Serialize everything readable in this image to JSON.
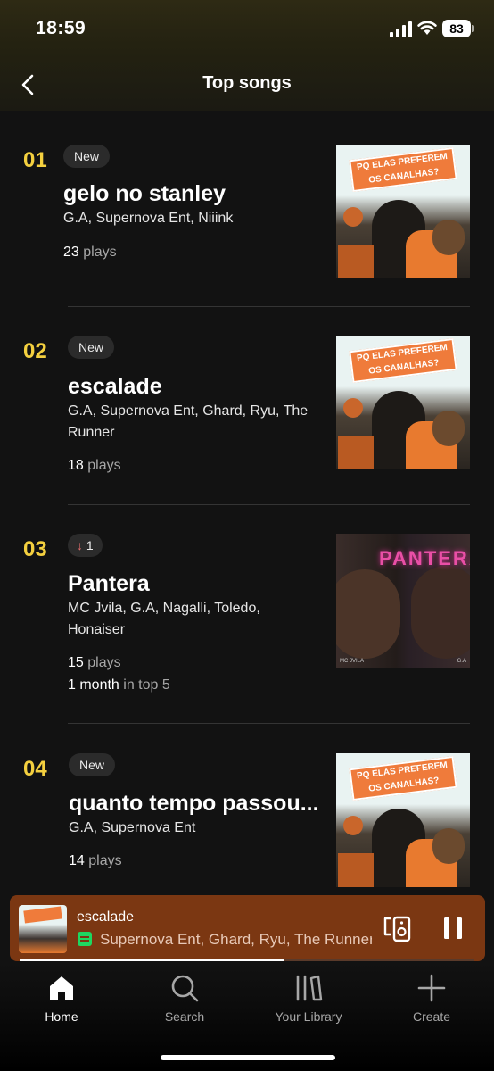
{
  "status_bar": {
    "time": "18:59",
    "battery": "83"
  },
  "header": {
    "title": "Top songs"
  },
  "songs": [
    {
      "rank": "01",
      "badge": "New",
      "title": "gelo no stanley",
      "artists": "G.A, Supernova Ent, Niiink",
      "plays_count": "23",
      "plays_label": "plays",
      "cover_text": "PQ ELAS PREFEREM OS CANALHAS?"
    },
    {
      "rank": "02",
      "badge": "New",
      "title": "escalade",
      "artists": "G.A, Supernova Ent, Ghard, Ryu, The Runner",
      "plays_count": "18",
      "plays_label": "plays",
      "cover_text": "PQ ELAS PREFEREM OS CANALHAS?"
    },
    {
      "rank": "03",
      "badge_arrow": "↓",
      "badge": "1",
      "title": "Pantera",
      "artists": "MC Jvila, G.A, Nagalli, Toledo, Honaiser",
      "plays_count": "15",
      "plays_label": "plays",
      "streak_value": "1 month",
      "streak_label": "in top 5",
      "cover_text": "PANTERA",
      "cover_credit_left": "MC JVILA",
      "cover_credit_right": "G.A"
    },
    {
      "rank": "04",
      "badge": "New",
      "title": "quanto tempo passou...",
      "artists": "G.A, Supernova Ent",
      "plays_count": "14",
      "plays_label": "plays",
      "cover_text": "PQ ELAS PREFEREM OS CANALHAS?"
    }
  ],
  "now_playing": {
    "title": "escalade",
    "artists": "Supernova Ent, Ghard, Ryu, The Runner",
    "progress": 0.58,
    "connect_icon": "connect-device-icon",
    "pause_icon": "pause-icon"
  },
  "tabs": [
    {
      "label": "Home",
      "icon": "home-icon",
      "active": true
    },
    {
      "label": "Search",
      "icon": "search-icon",
      "active": false
    },
    {
      "label": "Your Library",
      "icon": "library-icon",
      "active": false
    },
    {
      "label": "Create",
      "icon": "plus-icon",
      "active": false
    }
  ],
  "colors": {
    "rank": "#f4d03f",
    "background": "#121212",
    "mini_player": "#7b3712",
    "accent_green": "#1ed760",
    "down_arrow": "#e06b6b"
  }
}
